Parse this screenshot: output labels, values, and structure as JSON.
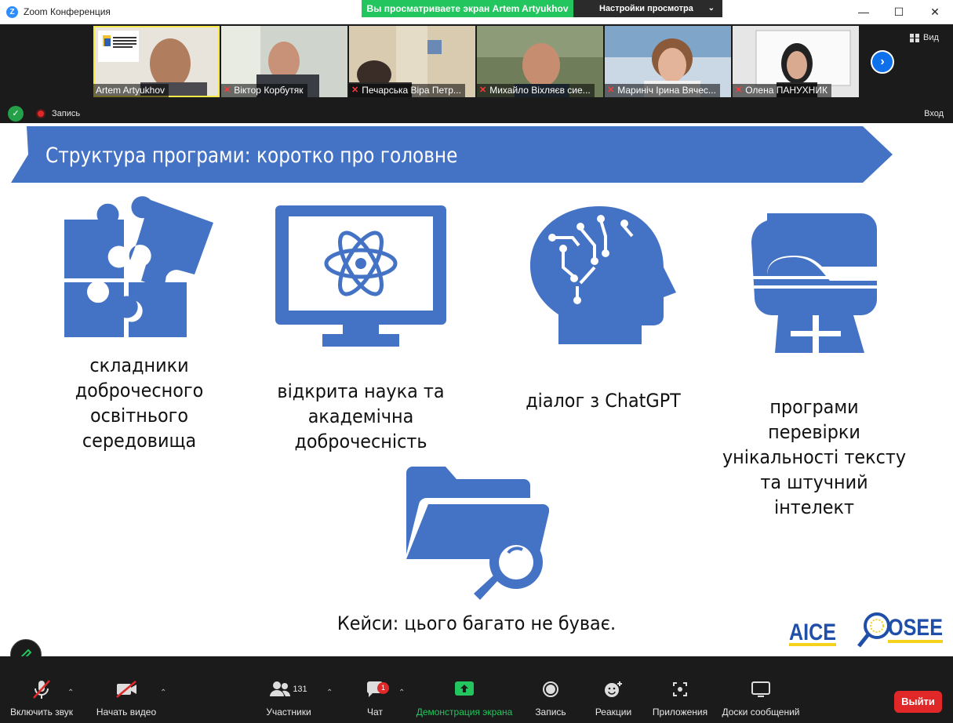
{
  "app": {
    "title": "Zoom Конференция",
    "icon_letter": "Z"
  },
  "share": {
    "banner": "Вы просматриваете экран Artem Artyukhov",
    "view_options": "Настройки просмотра"
  },
  "gallery": {
    "participants": [
      {
        "name": "Artem Artyukhov",
        "muted": false,
        "active": true
      },
      {
        "name": "Віктор Корбутяк",
        "muted": true,
        "active": false
      },
      {
        "name": "Печарська Віра Петр...",
        "muted": true,
        "active": false
      },
      {
        "name": "Михайло Віхляєв сие...",
        "muted": true,
        "active": false
      },
      {
        "name": "Мариніч Ірина Вячес...",
        "muted": true,
        "active": false
      },
      {
        "name": "Олена ПАНУХНИК",
        "muted": true,
        "active": false
      }
    ],
    "view_label": "Вид"
  },
  "status": {
    "record_label": "Запись",
    "exit_label": "Вход"
  },
  "slide": {
    "title": "Структура програми: коротко про головне",
    "captions": [
      "складники\nдоброчесного\nосвітнього\nсередовища",
      "відкрита наука та\nакадемічна\nдоброчесність",
      "діалог з ChatGPT",
      "програми\nперевірки\nунікальності тексту\nта штучний\nінтелект",
      "Кейси: цього багато не буває."
    ],
    "accent_color": "#4472c4",
    "logos": {
      "aice": "AICE",
      "osee": "OSEE"
    }
  },
  "toolbar": {
    "mute": "Включить звук",
    "video": "Начать видео",
    "participants": "Участники",
    "participants_count": "131",
    "chat": "Чат",
    "chat_badge": "1",
    "share": "Демонстрация экрана",
    "record": "Запись",
    "reactions": "Реакции",
    "apps": "Приложения",
    "whiteboards": "Доски сообщений",
    "leave": "Выйти"
  }
}
